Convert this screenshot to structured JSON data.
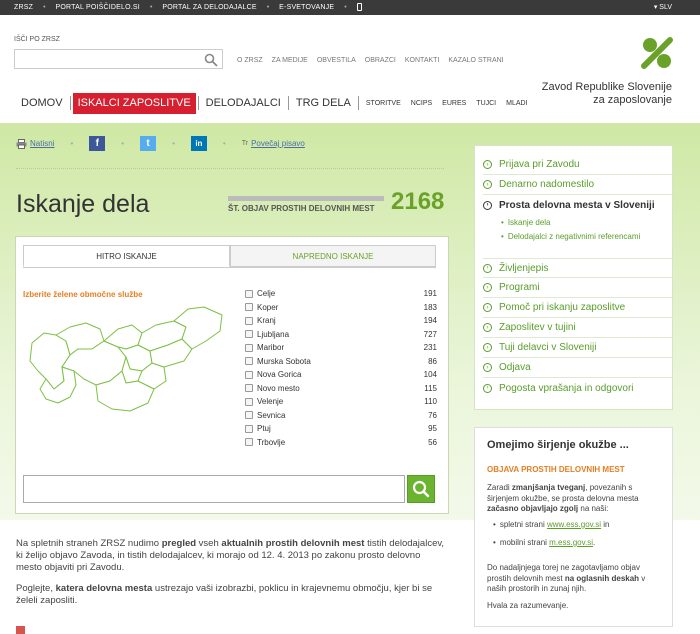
{
  "topbar": {
    "links": [
      "ZRSZ",
      "PORTAL POIŠČIDELO.SI",
      "PORTAL ZA DELODAJALCE",
      "E-SVETOVANJE"
    ],
    "lang": "SLV"
  },
  "header": {
    "search_label": "IŠČI PO ZRSZ",
    "search_value": "",
    "util_nav": [
      "O ZRSZ",
      "ZA MEDIJE",
      "OBVESTILA",
      "OBRAZCI",
      "KONTAKTI",
      "KAZALO STRANI"
    ],
    "org_name_line1": "Zavod Republike Slovenije",
    "org_name_line2": "za zaposlovanje"
  },
  "main_nav": {
    "big": [
      "DOMOV",
      "ISKALCI ZAPOSLITVE",
      "DELODAJALCI",
      "TRG DELA"
    ],
    "small": [
      "STORITVE",
      "NCIPS",
      "EURES",
      "TUJCI",
      "MLADI"
    ]
  },
  "share": {
    "print_label": "Natisni",
    "fb": "f",
    "tw": "t",
    "li": "in",
    "font_label": "Povečaj pisavo",
    "font_icon": "Tr"
  },
  "page": {
    "title": "Iskanje dela",
    "count_label": "ŠT. OBJAV PROSTIH DELOVNIH MEST",
    "count": "2168"
  },
  "search_panel": {
    "tab_quick": "HITRO ISKANJE",
    "tab_advanced": "NAPREDNO ISKANJE",
    "region_title": "Izberite želene območne službe",
    "regions": [
      {
        "name": "Celje",
        "count": "191"
      },
      {
        "name": "Koper",
        "count": "183"
      },
      {
        "name": "Kranj",
        "count": "194"
      },
      {
        "name": "Ljubljana",
        "count": "727"
      },
      {
        "name": "Maribor",
        "count": "231"
      },
      {
        "name": "Murska Sobota",
        "count": "86"
      },
      {
        "name": "Nova Gorica",
        "count": "104"
      },
      {
        "name": "Novo mesto",
        "count": "115"
      },
      {
        "name": "Velenje",
        "count": "110"
      },
      {
        "name": "Sevnica",
        "count": "76"
      },
      {
        "name": "Ptuj",
        "count": "95"
      },
      {
        "name": "Trbovlje",
        "count": "56"
      }
    ],
    "quick_value": ""
  },
  "body": {
    "p1_a": "Na spletnih straneh ZRSZ nudimo ",
    "p1_b": "pregled",
    "p1_c": " vseh ",
    "p1_d": "aktualnih prostih delovnih mest",
    "p1_e": " tistih delodajalcev, ki želijo objavo Zavoda, in tistih delodajalcev, ki morajo od 12. 4. 2013 po zakonu prosto delovno mesto objaviti pri Zavodu.",
    "p2_a": "Poglejte, ",
    "p2_b": "katera delovna mesta",
    "p2_c": " ustrezajo vaši izobrazbi, poklicu in krajevnemu območju, kjer bi se želeli zaposliti."
  },
  "sidebar": {
    "items_top": [
      "Prijava pri Zavodu",
      "Denarno nadomestilo"
    ],
    "current": "Prosta delovna mesta v Sloveniji",
    "sub_items": [
      "Iskanje dela",
      "Delodajalci z negativnimi referencami"
    ],
    "items_bottom": [
      "Življenjepis",
      "Programi",
      "Pomoč pri iskanju zaposlitve",
      "Zaposlitev v tujini",
      "Tuji delavci v Sloveniji",
      "Odjava",
      "Pogosta vprašanja in odgovori"
    ]
  },
  "covid": {
    "title": "Omejimo širjenje okužbe ...",
    "subtitle": "OBJAVA PROSTIH DELOVNIH MEST",
    "p1_a": "Zaradi ",
    "p1_b": "zmanjšanja tveganj",
    "p1_c": ", povezanih s širjenjem okužbe, se prosta delovna mesta ",
    "p1_d": "začasno objavljajo zgolj",
    "p1_e": " na naši:",
    "b1_a": "spletni strani ",
    "b1_link": "www.ess.gov.si",
    "b1_b": " in",
    "b2_a": "mobilni strani ",
    "b2_link": "m.ess.gov.si",
    "b2_b": ".",
    "p2_a": "Do nadaljnjega torej ne zagotavljamo objav prostih delovnih mest ",
    "p2_b": "na oglasnih deskah",
    "p2_c": " v naših prostorih in zunaj njih.",
    "p3": "Hvala za razumevanje."
  },
  "colors": {
    "accent_green": "#6aa229",
    "nav_active_red": "#d6202f",
    "link_blue": "#4a6fa5",
    "orange": "#e67e22"
  }
}
